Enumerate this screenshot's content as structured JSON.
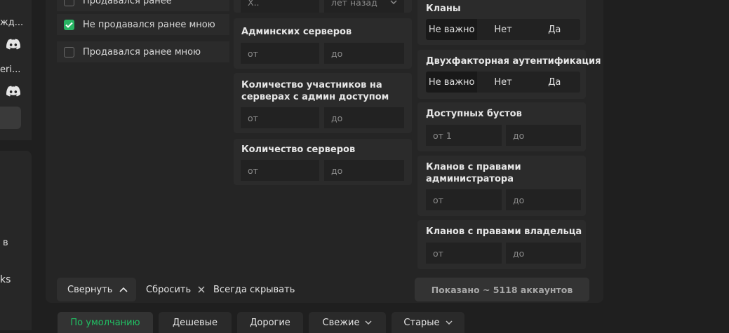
{
  "sidebar": {
    "item1_label": "жд...",
    "item2_label": "eri...",
    "item3_label": "в",
    "item4_label": "ks"
  },
  "checkboxes": [
    {
      "label": "Продавался ранее",
      "checked": false
    },
    {
      "label": "Не продавался ранее мною",
      "checked": true
    },
    {
      "label": "Продавался ранее мною",
      "checked": false
    }
  ],
  "top_fields": {
    "partial_input": "Х..",
    "years_ago_select": "лет назад"
  },
  "filters_mid": [
    {
      "title": "Админских серверов",
      "from": "от",
      "to": "до"
    },
    {
      "title": "Количество участников на серверах с админ доступом",
      "from": "от",
      "to": "до"
    },
    {
      "title": "Количество серверов",
      "from": "от",
      "to": "до"
    }
  ],
  "filters_right": {
    "clans": {
      "title": "Кланы",
      "options": [
        "Не важно",
        "Нет",
        "Да"
      ],
      "selected": "Не важно"
    },
    "two_factor": {
      "title": "Двухфакторная аутентификация",
      "options": [
        "Не важно",
        "Нет",
        "Да"
      ],
      "selected": "Не важно"
    },
    "boosts": {
      "title": "Доступных бустов",
      "from": "от 1",
      "to": "до"
    },
    "clan_admin": {
      "title": "Кланов с правами администратора",
      "from": "от",
      "to": "до"
    },
    "clan_owner": {
      "title": "Кланов с правами владельца",
      "from": "от",
      "to": "до"
    }
  },
  "controls": {
    "collapse": "Свернуть",
    "reset": "Сбросить",
    "always_hide": "Всегда скрывать",
    "shown": "Показано ~ 5118 аккаунтов"
  },
  "sort": [
    {
      "label": "По умолчанию",
      "active": true
    },
    {
      "label": "Дешевые",
      "active": false
    },
    {
      "label": "Дорогие",
      "active": false
    },
    {
      "label": "Свежие",
      "active": false,
      "dropdown": true
    },
    {
      "label": "Старые",
      "active": false,
      "dropdown": true
    }
  ],
  "colors": {
    "accent": "#21c064",
    "checkbox": "#28b463",
    "background": "#1f1f1f",
    "panel": "#252525"
  }
}
